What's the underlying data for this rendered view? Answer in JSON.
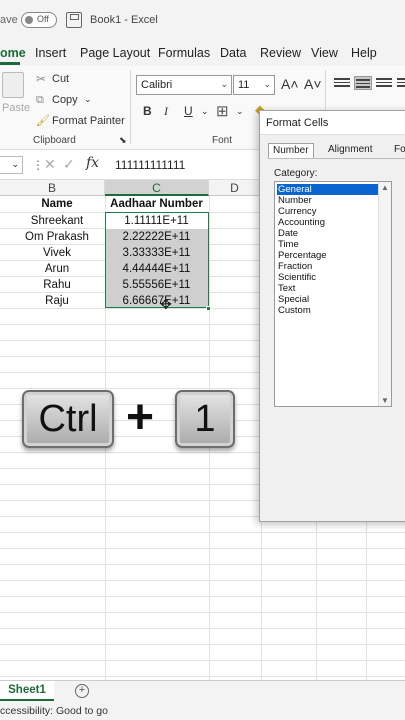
{
  "titlebar": {
    "autosave_label": "ave",
    "autosave_state": "Off",
    "title": "Book1  -  Excel"
  },
  "tabs": [
    "ome",
    "Insert",
    "Page Layout",
    "Formulas",
    "Data",
    "Review",
    "View",
    "Help"
  ],
  "ribbon": {
    "paste_label": "Paste",
    "cut_label": "Cut",
    "copy_label": "Copy",
    "format_painter_label": "Format Painter",
    "clipboard_group": "Clipboard",
    "font_name": "Calibri",
    "font_size": "11",
    "font_group": "Font",
    "bold": "B",
    "italic": "I",
    "underline": "U"
  },
  "formula_bar": {
    "fx_label": "fx",
    "value": "111111111111"
  },
  "sheet": {
    "columns": [
      "B",
      "C",
      "D"
    ],
    "header_name": "Name",
    "header_number": "Aadhaar Number",
    "rows": [
      {
        "name": "Shreekant",
        "number": "1.11111E+11"
      },
      {
        "name": "Om Prakash",
        "number": "2.22222E+11"
      },
      {
        "name": "Vivek",
        "number": "3.33333E+11"
      },
      {
        "name": "Arun",
        "number": "4.44444E+11"
      },
      {
        "name": "Rahu",
        "number": "5.55556E+11"
      },
      {
        "name": "Raju",
        "number": "6.66667E+11"
      }
    ]
  },
  "overlay": {
    "key1": "Ctrl",
    "plus": "+",
    "key2": "1"
  },
  "dialog": {
    "title": "Format Cells",
    "tabs": [
      "Number",
      "Alignment",
      "For"
    ],
    "category_label": "Category:",
    "categories": [
      "General",
      "Number",
      "Currency",
      "Accounting",
      "Date",
      "Time",
      "Percentage",
      "Fraction",
      "Scientific",
      "Text",
      "Special",
      "Custom"
    ],
    "selected_category": "General"
  },
  "bottom": {
    "sheet_tab": "Sheet1",
    "add_sheet": "+",
    "status": "ccessibility: Good to go"
  },
  "colors": {
    "excel_green": "#1e6b3a",
    "selection_blue": "#0a64d0"
  }
}
